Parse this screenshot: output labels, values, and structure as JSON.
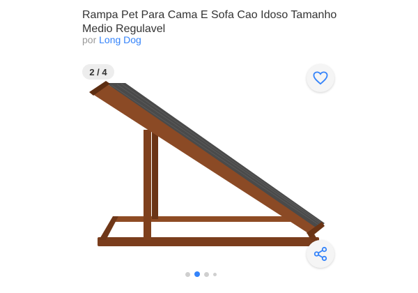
{
  "product": {
    "title_line1": "Rampa Pet Para Cama E Sofa Cao Idoso Tamanho",
    "title_line2": "Medio Regulavel",
    "seller_prefix": "por",
    "seller_name": "Long Dog"
  },
  "gallery": {
    "counter": "2 / 4",
    "current_index": 2,
    "total": 4,
    "image_subject": "wooden pet ramp with grey carpet surface"
  },
  "actions": {
    "favorite_icon": "heart-icon",
    "share_icon": "share-icon"
  },
  "colors": {
    "accent": "#3483fa",
    "wood": "#8b4a25",
    "carpet": "#4a4a4a"
  }
}
